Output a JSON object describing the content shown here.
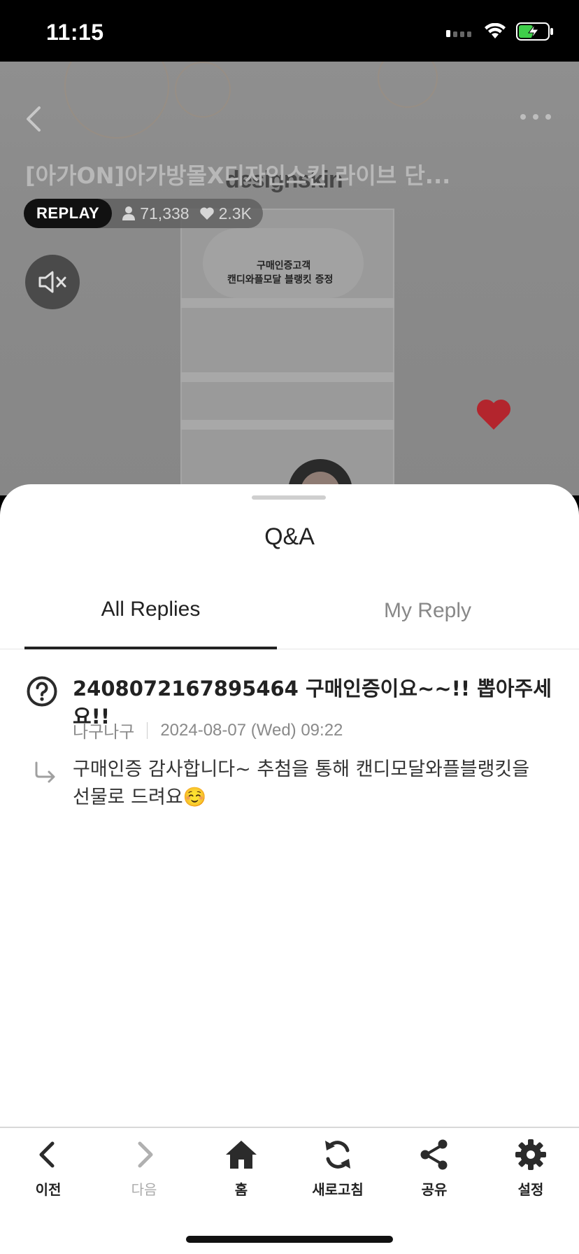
{
  "status_bar": {
    "time": "11:15"
  },
  "video": {
    "title": "[아가ON]아가방몰X디자인스킨 라이브 단...",
    "badge": "REPLAY",
    "viewers": "71,338",
    "likes": "2.3K",
    "background_brand": "designskin",
    "background_poster_line1": "구매인증고객",
    "background_poster_line2": "캔디와플모달 블랭킷 증정"
  },
  "sheet": {
    "title": "Q&A",
    "tabs": [
      {
        "label": "All Replies",
        "active": true
      },
      {
        "label": "My Reply",
        "active": false
      }
    ]
  },
  "qa": [
    {
      "question": "2408072167895464 구매인증이요~~!! 뽑아주세요!!",
      "author": "나구나구",
      "datetime": "2024-08-07 (Wed) 09:22",
      "reply": "구매인증 감사합니다~ 추첨을 통해 캔디모달와플블랭킷을 선물로 드려요☺️"
    }
  ],
  "bottom_nav": [
    {
      "label": "이전",
      "icon": "chevron-left-icon"
    },
    {
      "label": "다음",
      "icon": "chevron-right-icon",
      "disabled": true
    },
    {
      "label": "홈",
      "icon": "home-icon"
    },
    {
      "label": "새로고침",
      "icon": "refresh-icon"
    },
    {
      "label": "공유",
      "icon": "share-icon"
    },
    {
      "label": "설정",
      "icon": "gear-icon"
    }
  ],
  "colors": {
    "heart": "#b3252d",
    "active_tab_underline": "#222222",
    "battery_green": "#3fcf4a"
  }
}
